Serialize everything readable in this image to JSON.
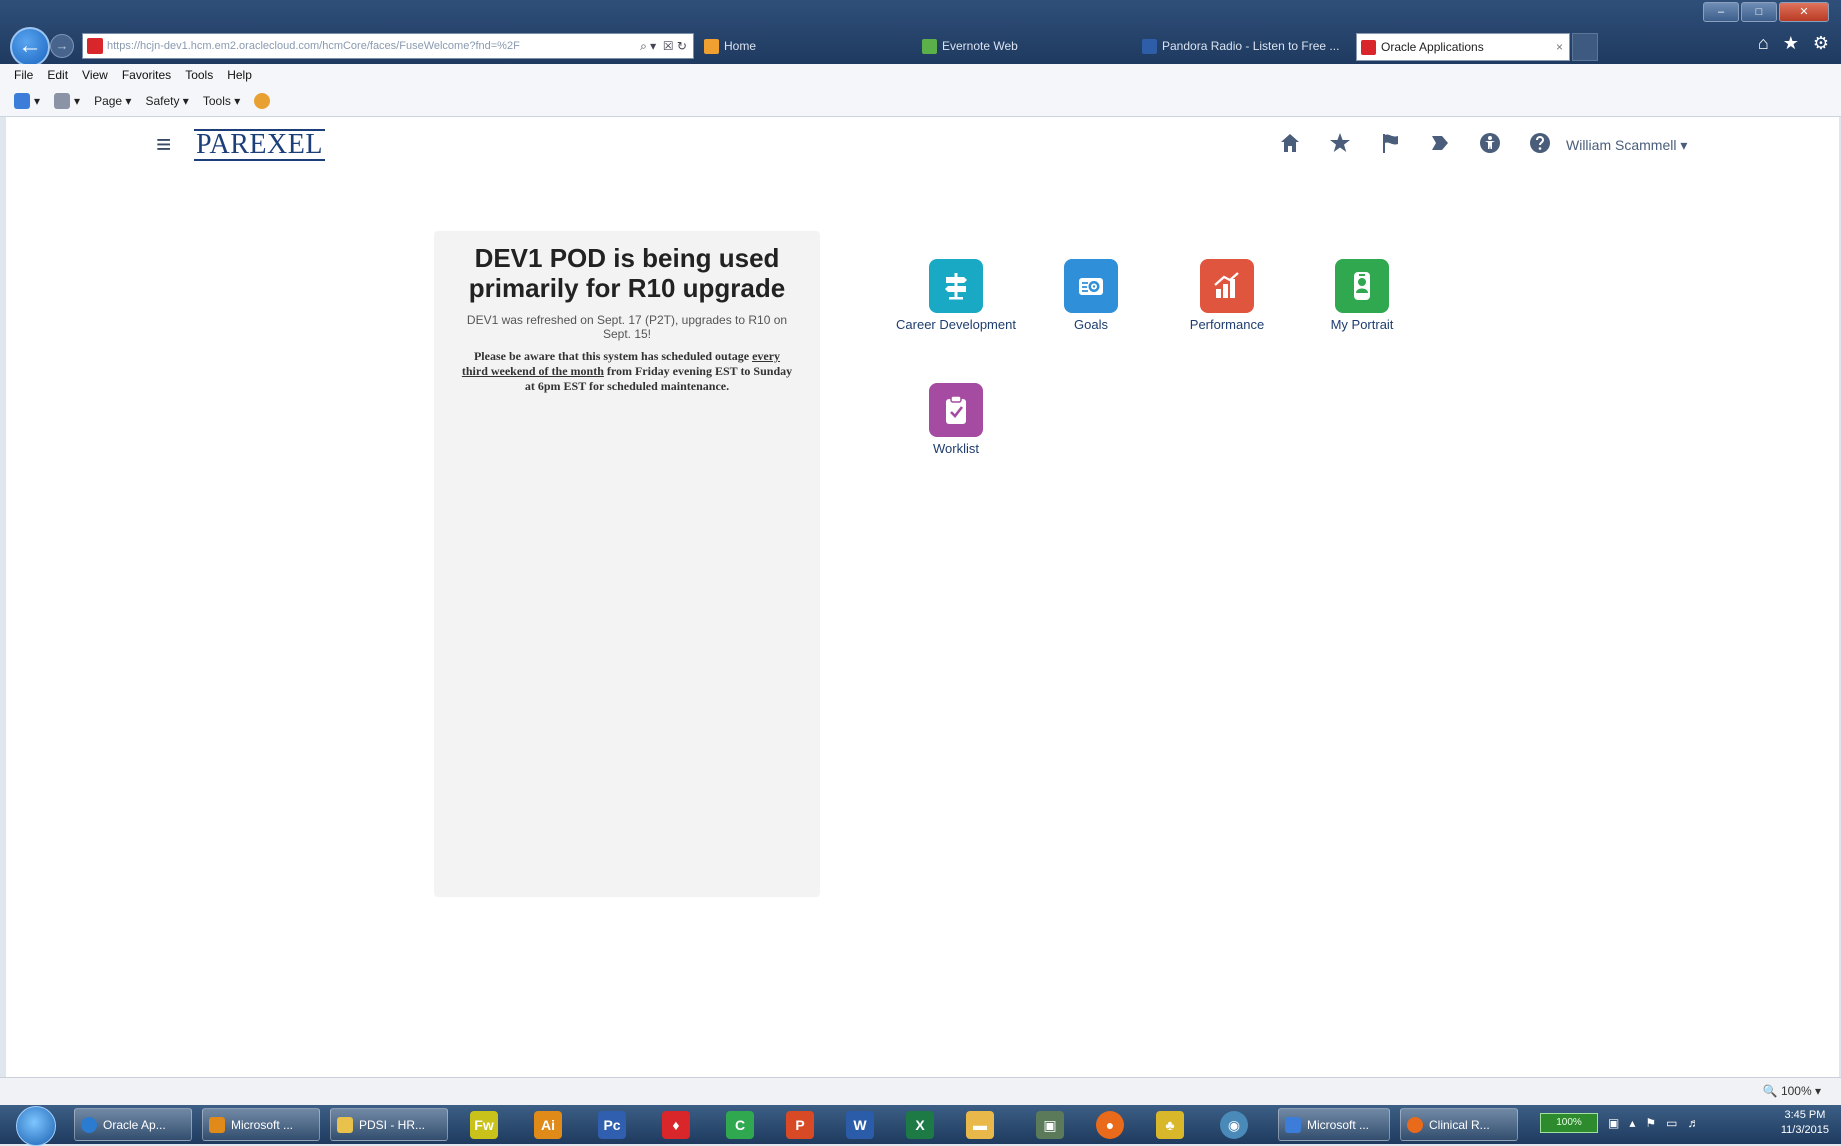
{
  "browser": {
    "address": {
      "url": "https://hcjn-dev1.hcm.em2.oraclecloud.com/hcmCore/faces/FuseWelcome?fnd=%2F",
      "actions": "⌕ ▾  ☒ ↻"
    },
    "tabs": [
      {
        "label": "Home",
        "color": "#f0a030"
      },
      {
        "label": "Evernote Web",
        "color": "#5bb04a"
      },
      {
        "label": "Pandora Radio - Listen to Free ...",
        "color": "#2e5ea8"
      },
      {
        "label": "Oracle Applications",
        "color": "#d8262b",
        "close": "×"
      }
    ],
    "menu": [
      "File",
      "Edit",
      "View",
      "Favorites",
      "Tools",
      "Help"
    ],
    "commands": [
      {
        "label": "▾",
        "icon": "home-icon"
      },
      {
        "label": "▾",
        "icon": "feeds-icon"
      },
      {
        "label": "Page ▾",
        "icon": ""
      },
      {
        "label": "Safety ▾",
        "icon": ""
      },
      {
        "label": "Tools ▾",
        "icon": ""
      }
    ],
    "zoom": "🔍 100% ▾"
  },
  "header": {
    "hamburger": "≡",
    "logo": "PAREXEL",
    "user": "William Scammell ▾"
  },
  "announcement": {
    "title": "DEV1 POD is being used primarily for R10 upgrade",
    "line1": "DEV1 was refreshed on Sept. 17 (P2T), upgrades to R10 on Sept. 15!",
    "line2_pre": "Please be aware that this system has scheduled outage ",
    "line2_link": "every third weekend of the month",
    "line2_post": " from Friday evening EST to Sunday at 6pm EST for scheduled maintenance."
  },
  "apps": [
    {
      "label": "Career Development",
      "color": "#1aa9c4",
      "icon": "signpost-icon"
    },
    {
      "label": "Goals",
      "color": "#2f8fd8",
      "icon": "goals-icon"
    },
    {
      "label": "Performance",
      "color": "#e0553e",
      "icon": "performance-chart-icon"
    },
    {
      "label": "My Portrait",
      "color": "#2fa84f",
      "icon": "portrait-icon"
    },
    {
      "label": "Worklist",
      "color": "#a64ba2",
      "icon": "clipboard-check-icon"
    }
  ],
  "taskbar": {
    "items": [
      {
        "label": "Oracle Ap...",
        "color": "#2b7bd1"
      },
      {
        "label": "Microsoft ...",
        "color": "#e08a1a"
      },
      {
        "label": "PDSI - HR...",
        "color": "#e8c24a"
      },
      {
        "label": "Microsoft ...",
        "color": "#3b7dd8"
      },
      {
        "label": "Clinical R...",
        "color": "#e86a1a"
      }
    ],
    "apps": [
      {
        "label": "Fw",
        "color": "#c9c21a"
      },
      {
        "label": "Ai",
        "color": "#e08a1a"
      },
      {
        "label": "Pc",
        "color": "#2f5fae"
      },
      {
        "label": "♦",
        "color": "#d8262b"
      },
      {
        "label": "C",
        "color": "#2fa84f"
      },
      {
        "label": "P",
        "color": "#d84a26"
      },
      {
        "label": "W",
        "color": "#2b5caa"
      },
      {
        "label": "X",
        "color": "#1e7a45"
      },
      {
        "label": "▬",
        "color": "#e8b84a"
      },
      {
        "label": "▣",
        "color": "#5a7a5a"
      },
      {
        "label": "●",
        "color": "#e86a1a"
      },
      {
        "label": "♣",
        "color": "#d8b82a"
      },
      {
        "label": "◉",
        "color": "#4a8ab8"
      }
    ],
    "battery": "100%",
    "time": "3:45 PM",
    "date": "11/3/2015"
  }
}
